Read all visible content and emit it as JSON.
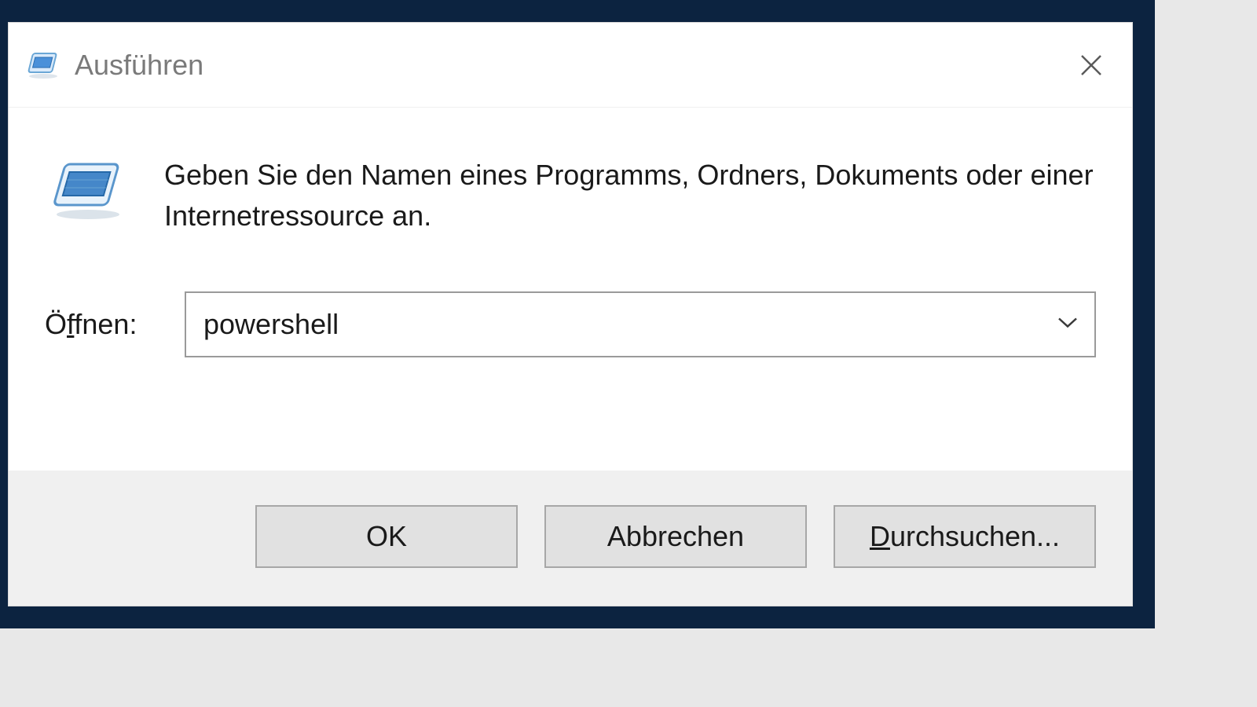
{
  "titlebar": {
    "title": "Ausführen"
  },
  "content": {
    "description": "Geben Sie den Namen eines Programms, Ordners, Dokuments oder einer Internetressource an.",
    "open_label_prefix": "Ö",
    "open_label_underlined": "f",
    "open_label_suffix": "fnen:",
    "input_value": "powershell"
  },
  "buttons": {
    "ok": "OK",
    "cancel": "Abbrechen",
    "browse_underlined": "D",
    "browse_suffix": "urchsuchen..."
  }
}
